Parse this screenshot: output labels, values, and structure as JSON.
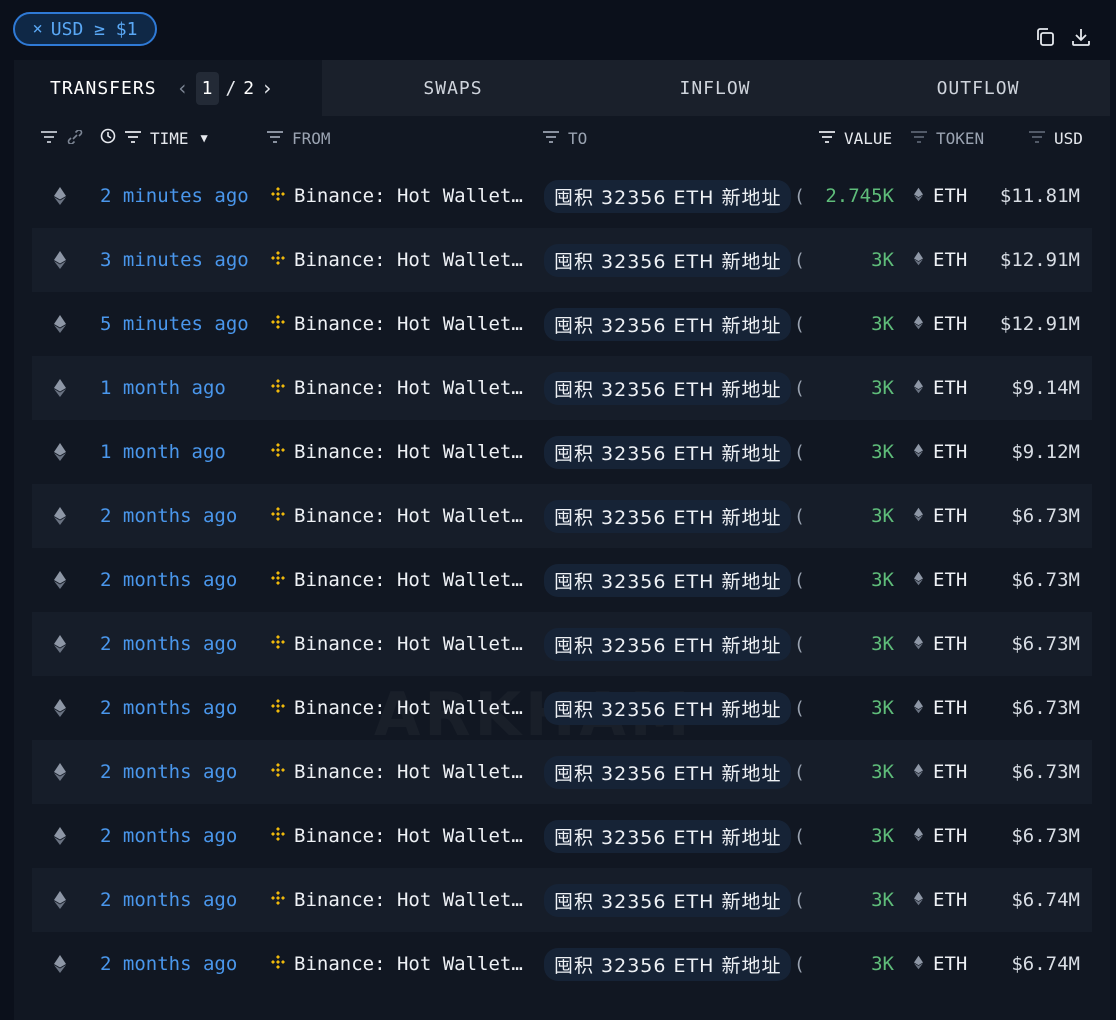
{
  "filter_chip": {
    "close": "×",
    "label": "USD ≥ $1"
  },
  "tabs": {
    "transfers": "TRANSFERS",
    "swaps": "SWAPS",
    "inflow": "INFLOW",
    "outflow": "OUTFLOW",
    "page_current": "1",
    "page_sep": "/",
    "page_total": "2"
  },
  "columns": {
    "time": "TIME",
    "from": "FROM",
    "to": "TO",
    "value": "VALUE",
    "token": "TOKEN",
    "usd": "USD"
  },
  "watermark": "ARKHAM",
  "colors": {
    "accent_blue": "#4a97ec",
    "value_green": "#5fbd7a",
    "binance_yellow": "#f0b90b",
    "background": "#0b101b"
  },
  "rows": [
    {
      "time": "2 minutes ago",
      "from": "Binance: Hot Wallet…",
      "to": "囤积 32356 ETH 新地址",
      "paren": "(",
      "value": "2.745K",
      "token": "ETH",
      "usd": "$11.81M"
    },
    {
      "time": "3 minutes ago",
      "from": "Binance: Hot Wallet…",
      "to": "囤积 32356 ETH 新地址",
      "paren": "(",
      "value": "3K",
      "token": "ETH",
      "usd": "$12.91M"
    },
    {
      "time": "5 minutes ago",
      "from": "Binance: Hot Wallet…",
      "to": "囤积 32356 ETH 新地址",
      "paren": "(",
      "value": "3K",
      "token": "ETH",
      "usd": "$12.91M"
    },
    {
      "time": "1 month ago",
      "from": "Binance: Hot Wallet…",
      "to": "囤积 32356 ETH 新地址",
      "paren": "(",
      "value": "3K",
      "token": "ETH",
      "usd": "$9.14M"
    },
    {
      "time": "1 month ago",
      "from": "Binance: Hot Wallet…",
      "to": "囤积 32356 ETH 新地址",
      "paren": "(",
      "value": "3K",
      "token": "ETH",
      "usd": "$9.12M"
    },
    {
      "time": "2 months ago",
      "from": "Binance: Hot Wallet…",
      "to": "囤积 32356 ETH 新地址",
      "paren": "(",
      "value": "3K",
      "token": "ETH",
      "usd": "$6.73M"
    },
    {
      "time": "2 months ago",
      "from": "Binance: Hot Wallet…",
      "to": "囤积 32356 ETH 新地址",
      "paren": "(",
      "value": "3K",
      "token": "ETH",
      "usd": "$6.73M"
    },
    {
      "time": "2 months ago",
      "from": "Binance: Hot Wallet…",
      "to": "囤积 32356 ETH 新地址",
      "paren": "(",
      "value": "3K",
      "token": "ETH",
      "usd": "$6.73M"
    },
    {
      "time": "2 months ago",
      "from": "Binance: Hot Wallet…",
      "to": "囤积 32356 ETH 新地址",
      "paren": "(",
      "value": "3K",
      "token": "ETH",
      "usd": "$6.73M"
    },
    {
      "time": "2 months ago",
      "from": "Binance: Hot Wallet…",
      "to": "囤积 32356 ETH 新地址",
      "paren": "(",
      "value": "3K",
      "token": "ETH",
      "usd": "$6.73M"
    },
    {
      "time": "2 months ago",
      "from": "Binance: Hot Wallet…",
      "to": "囤积 32356 ETH 新地址",
      "paren": "(",
      "value": "3K",
      "token": "ETH",
      "usd": "$6.73M"
    },
    {
      "time": "2 months ago",
      "from": "Binance: Hot Wallet…",
      "to": "囤积 32356 ETH 新地址",
      "paren": "(",
      "value": "3K",
      "token": "ETH",
      "usd": "$6.74M"
    },
    {
      "time": "2 months ago",
      "from": "Binance: Hot Wallet…",
      "to": "囤积 32356 ETH 新地址",
      "paren": "(",
      "value": "3K",
      "token": "ETH",
      "usd": "$6.74M"
    }
  ]
}
